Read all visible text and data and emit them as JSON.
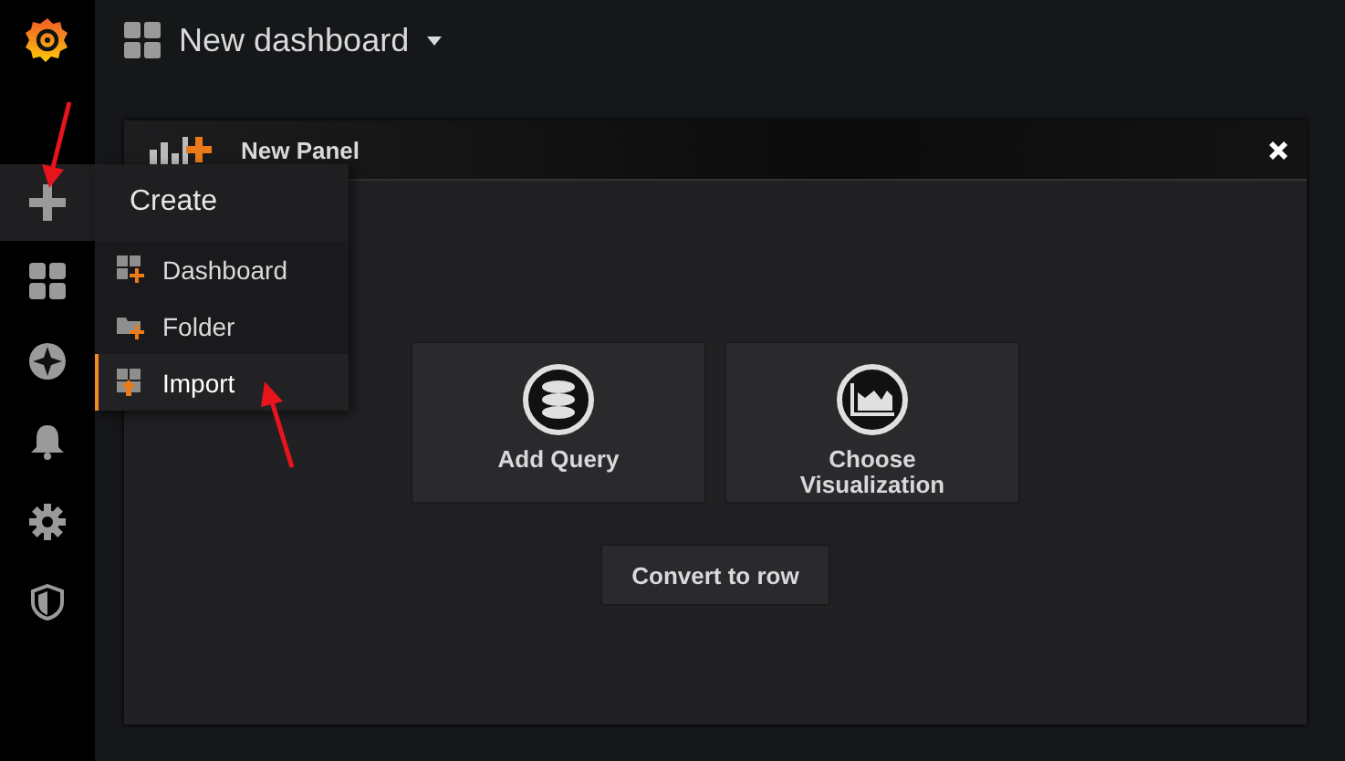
{
  "top_bar": {
    "title": "New dashboard"
  },
  "sidebar": {
    "items": [
      {
        "selected": true
      },
      {
        "selected": false
      },
      {
        "selected": false
      },
      {
        "selected": false
      },
      {
        "selected": false
      },
      {
        "selected": false
      }
    ]
  },
  "create_menu": {
    "title": "Create",
    "items": [
      {
        "label": "Dashboard",
        "selected": false
      },
      {
        "label": "Folder",
        "selected": false
      },
      {
        "label": "Import",
        "selected": true
      }
    ]
  },
  "panel": {
    "title": "New Panel",
    "actions": [
      {
        "label": "Add Query"
      },
      {
        "label": "Choose Visualization"
      }
    ],
    "convert_button": "Convert to row"
  }
}
